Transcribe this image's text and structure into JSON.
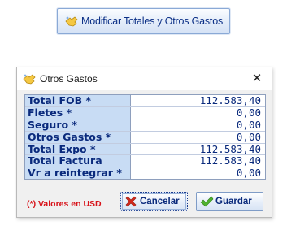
{
  "launcher": {
    "label": "Modificar Totales y Otros Gastos",
    "icon": "hand-pointer-icon"
  },
  "dialog": {
    "title": "Otros Gastos",
    "close_symbol": "✕",
    "rows": [
      {
        "label": "Total FOB *",
        "value": "112.583,40"
      },
      {
        "label": "Fletes *",
        "value": "0,00"
      },
      {
        "label": "Seguro *",
        "value": "0,00"
      },
      {
        "label": "Otros Gastos *",
        "value": "0,00"
      },
      {
        "label": "Total Expo *",
        "value": "112.583,40"
      },
      {
        "label": "Total Factura",
        "value": "112.583,40"
      },
      {
        "label": "Vr a reintegrar *",
        "value": "0,00"
      }
    ],
    "currency_note": "(*) Valores en  USD",
    "cancel_label": "Cancelar",
    "save_label": "Guardar"
  },
  "colors": {
    "label_bg": "#c8dcf4",
    "text_blue": "#0a2a7c",
    "note_red": "#d8141b",
    "cancel_icon": "#d42a1d",
    "save_icon": "#4fb12f"
  }
}
